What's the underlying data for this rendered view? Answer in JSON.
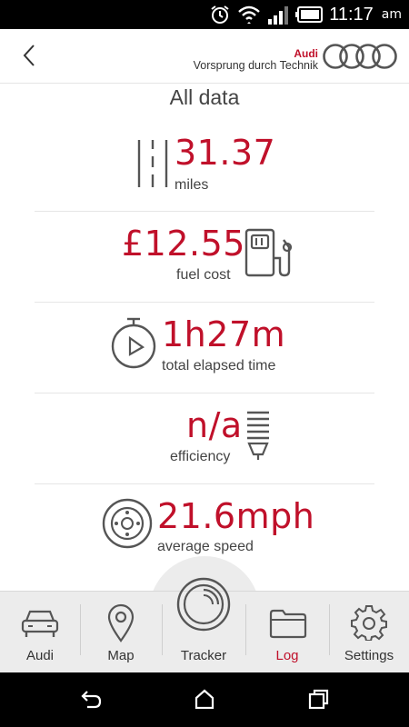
{
  "status_bar": {
    "time": "11:17",
    "ampm": "am"
  },
  "header": {
    "brand_name": "Audi",
    "slogan": "Vorsprung durch Technik",
    "back_icon": "chevron-left-icon",
    "logo_icon": "audi-rings-logo"
  },
  "page": {
    "title": "All data"
  },
  "stats": [
    {
      "value": "31.37",
      "label": "miles",
      "icon": "road-icon"
    },
    {
      "value": "£12.55",
      "label": "fuel cost",
      "icon": "fuel-pump-icon"
    },
    {
      "value": "1h27m",
      "label": "total elapsed time",
      "icon": "stopwatch-icon"
    },
    {
      "value": "n/a",
      "label": "efficiency",
      "icon": "spark-plug-icon"
    },
    {
      "value": "21.6mph",
      "label": "average speed",
      "icon": "wheel-icon"
    }
  ],
  "nav": {
    "items": [
      {
        "label": "Audi",
        "icon": "car-icon"
      },
      {
        "label": "Map",
        "icon": "map-pin-icon"
      },
      {
        "label": "Tracker",
        "icon": "tracker-icon"
      },
      {
        "label": "Log",
        "icon": "folder-icon",
        "active": true
      },
      {
        "label": "Settings",
        "icon": "gear-icon"
      }
    ]
  },
  "colors": {
    "accent": "#c0102a",
    "text": "#444444",
    "nav_bg": "#ececec"
  }
}
